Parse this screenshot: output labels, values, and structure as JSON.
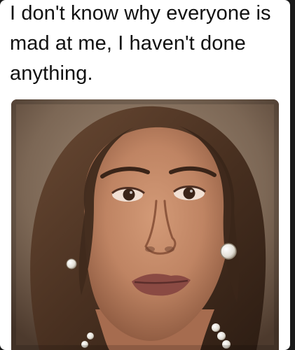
{
  "meme": {
    "caption": "I don't know why everyone is mad at me, I haven't done anything.",
    "photo_subject": "woman-face-photo"
  },
  "colors": {
    "page_background": "#1a1a1a",
    "card_background": "#ffffff",
    "caption_text": "#111111",
    "hair": "#4a3323",
    "skin": "#c48a68",
    "background_wall": "#8d7a68"
  }
}
